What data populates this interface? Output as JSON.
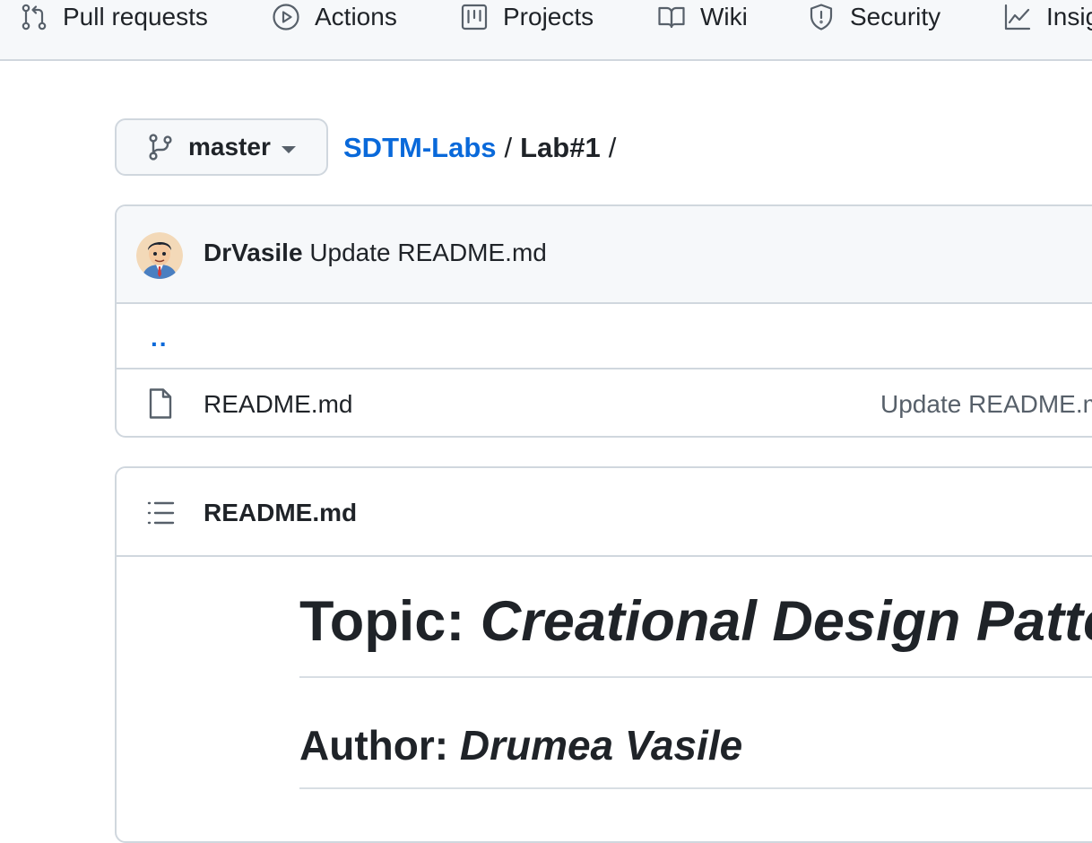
{
  "repo_nav": {
    "items": [
      {
        "label": "Pull requests",
        "icon": "pull-request-icon"
      },
      {
        "label": "Actions",
        "icon": "play-circle-icon"
      },
      {
        "label": "Projects",
        "icon": "project-board-icon"
      },
      {
        "label": "Wiki",
        "icon": "book-icon"
      },
      {
        "label": "Security",
        "icon": "shield-icon"
      },
      {
        "label": "Insig",
        "icon": "graph-icon"
      }
    ]
  },
  "branch": {
    "label": "master",
    "icon": "git-branch-icon"
  },
  "breadcrumb": {
    "repo": "SDTM-Labs",
    "separator": "/",
    "folder": "Lab#1",
    "trailing": "/"
  },
  "latest_commit": {
    "author": "DrVasile",
    "message": "Update README.md"
  },
  "files": {
    "parent_link": "..",
    "rows": [
      {
        "name": "README.md",
        "commit_message": "Update README.m",
        "icon": "file-icon"
      }
    ]
  },
  "readme": {
    "header_title": "README.md",
    "h1_prefix": "Topic: ",
    "h1_emphasis": "Creational Design Patter",
    "h2_prefix": "Author: ",
    "h2_emphasis": "Drumea Vasile"
  },
  "colors": {
    "link": "#0969da",
    "text": "#1f2328",
    "muted": "#57606a",
    "border": "#d0d7de",
    "subtle_bg": "#f6f8fa"
  }
}
